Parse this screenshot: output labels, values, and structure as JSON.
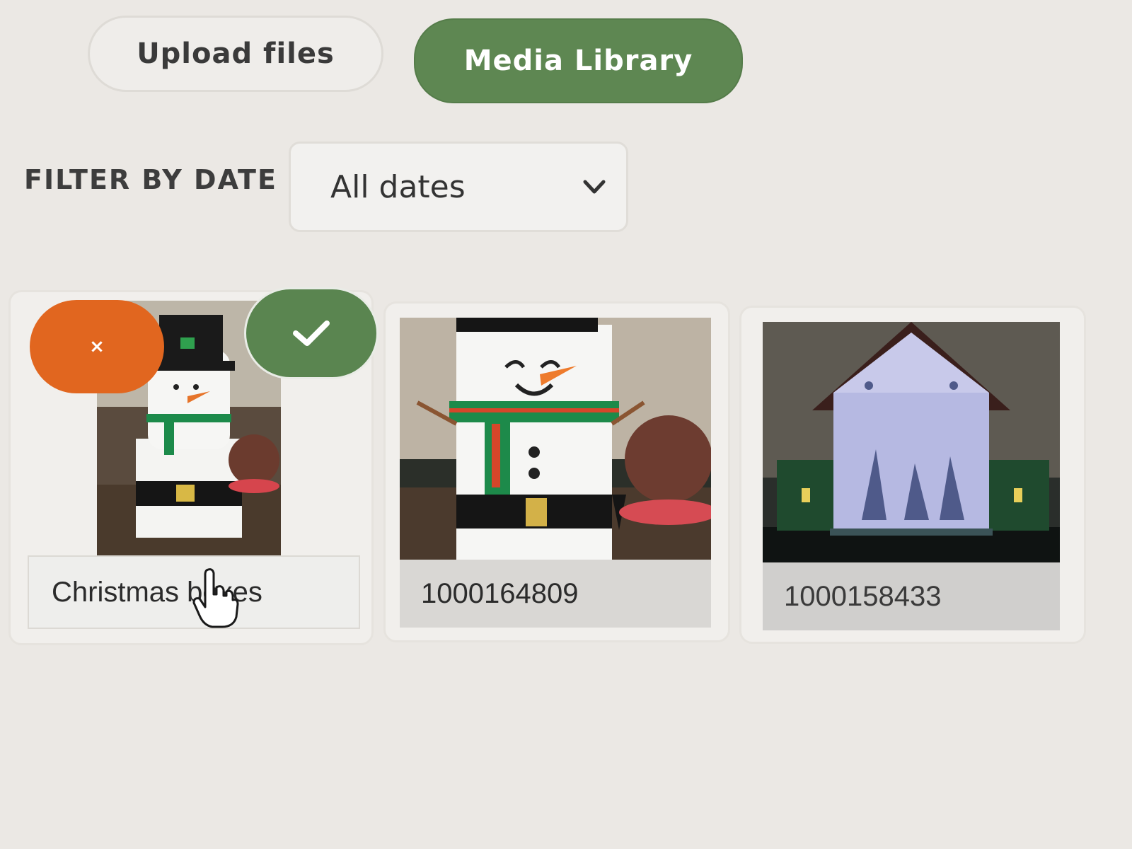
{
  "tabs": {
    "upload_label": "Upload files",
    "media_label": "Media Library",
    "active": "Media Library"
  },
  "filter": {
    "label": "FILTER BY DATE",
    "selected": "All dates"
  },
  "media": [
    {
      "caption": "Christmas boxes",
      "image": "snowman-box-thumbnail",
      "selected": true
    },
    {
      "caption": "1000164809",
      "image": "snowman-closeup-thumbnail",
      "selected": false
    },
    {
      "caption": "1000158433",
      "image": "nativity-lantern-thumbnail",
      "selected": false
    }
  ],
  "actions": {
    "remove_label": "×",
    "select_icon": "check-icon"
  },
  "colors": {
    "accent_green": "#5e8752",
    "remove_orange": "#e1661f",
    "background": "#ebe8e4"
  }
}
